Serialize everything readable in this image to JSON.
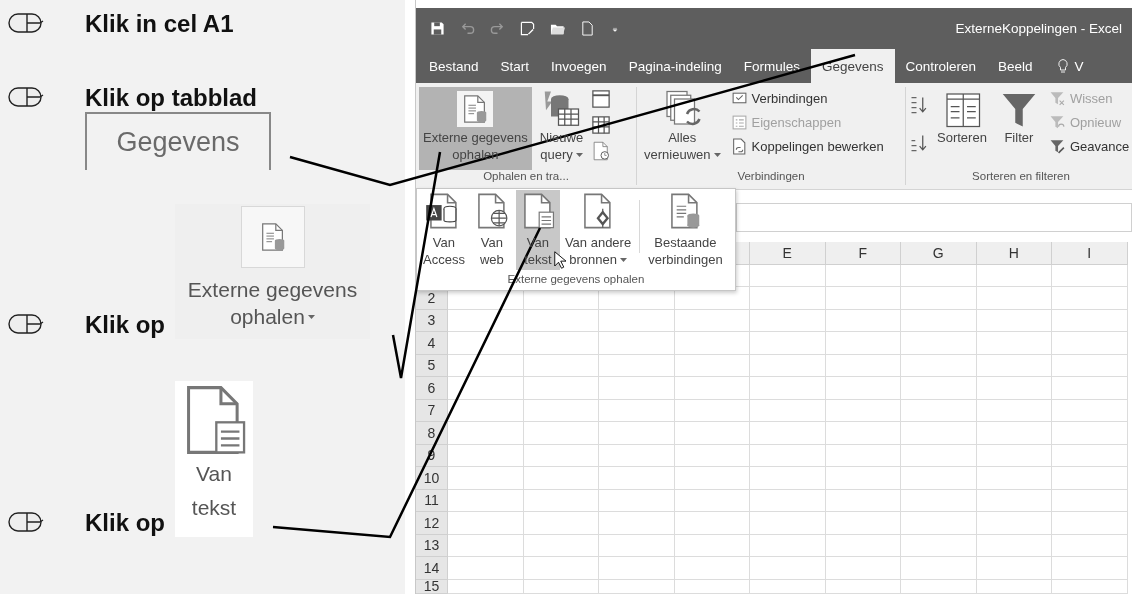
{
  "steps": [
    {
      "text": "Klik in cel A1"
    },
    {
      "text": "Klik op tabblad",
      "callout": {
        "kind": "tab",
        "lines": [
          "Gegevens"
        ]
      }
    },
    {
      "text": "Klik op",
      "callout": {
        "kind": "ribbon_button",
        "lines": [
          "Externe gegevens",
          "ophalen"
        ],
        "dropdown": true
      }
    },
    {
      "text": "Klik op",
      "callout": {
        "kind": "file_button",
        "lines": [
          "Van",
          "tekst"
        ]
      }
    }
  ],
  "excel": {
    "title": "ExterneKoppelingen  -  Excel",
    "tabs": [
      {
        "label": "Bestand",
        "kind": "tab",
        "selected": false
      },
      {
        "label": "Start",
        "kind": "tab",
        "selected": false
      },
      {
        "label": "Invoegen",
        "kind": "tab",
        "selected": false
      },
      {
        "label": "Pagina-indeling",
        "kind": "tab",
        "selected": false
      },
      {
        "label": "Formules",
        "kind": "tab",
        "selected": false
      },
      {
        "label": "Gegevens",
        "kind": "tab",
        "selected": true
      },
      {
        "label": "Controleren",
        "kind": "tab",
        "selected": false
      },
      {
        "label": "Beeld",
        "kind": "tab",
        "selected": false
      },
      {
        "label": "V",
        "kind": "tell_me",
        "selected": false
      }
    ],
    "ribbon": [
      {
        "label": "Ophalen en tra...",
        "items": [
          {
            "kind": "large",
            "lines": [
              "Externe gegevens",
              "ophalen"
            ],
            "pressed": true,
            "dropdown": false
          },
          {
            "kind": "large",
            "lines": [
              "Nieuwe",
              "query"
            ],
            "pressed": false,
            "dropdown": true
          },
          {
            "kind": "query_icons"
          }
        ]
      },
      {
        "label": "Verbindingen",
        "items": [
          {
            "kind": "large",
            "lines": [
              "Alles",
              "vernieuwen"
            ],
            "pressed": false,
            "dropdown": true
          },
          {
            "kind": "small_list",
            "entries": [
              {
                "label": "Verbindingen",
                "disabled": false
              },
              {
                "label": "Eigenschappen",
                "disabled": true
              },
              {
                "label": "Koppelingen bewerken",
                "disabled": false
              }
            ]
          }
        ]
      },
      {
        "label": "Sorteren en filteren",
        "items": [
          {
            "kind": "sort_icons"
          },
          {
            "kind": "large",
            "lines": [
              "Sorteren"
            ],
            "pressed": false,
            "dropdown": false
          },
          {
            "kind": "large",
            "lines": [
              "Filter"
            ],
            "pressed": false,
            "dropdown": false
          },
          {
            "kind": "small_list",
            "entries": [
              {
                "label": "Wissen",
                "disabled": true
              },
              {
                "label": "Opnieuw",
                "disabled": true
              },
              {
                "label": "Geavance",
                "disabled": false
              }
            ]
          }
        ]
      }
    ],
    "popup": {
      "label": "Externe gegevens ophalen",
      "items": [
        {
          "lines": [
            "Van",
            "Access"
          ],
          "selected": false,
          "dropdown": false
        },
        {
          "lines": [
            "Van",
            "web"
          ],
          "selected": false,
          "dropdown": false
        },
        {
          "lines": [
            "Van",
            "tekst"
          ],
          "selected": true,
          "dropdown": false
        },
        {
          "lines": [
            "Van andere",
            "bronnen"
          ],
          "selected": false,
          "dropdown": true
        },
        {
          "lines": [
            "Bestaande",
            "verbindingen"
          ],
          "selected": false,
          "dropdown": false
        }
      ]
    },
    "column_headers": [
      "E",
      "F",
      "G",
      "H",
      "I"
    ],
    "row_headers": [
      "2",
      "3",
      "4",
      "5",
      "6",
      "7",
      "8",
      "9",
      "10",
      "11",
      "12",
      "13",
      "14",
      "15"
    ]
  }
}
